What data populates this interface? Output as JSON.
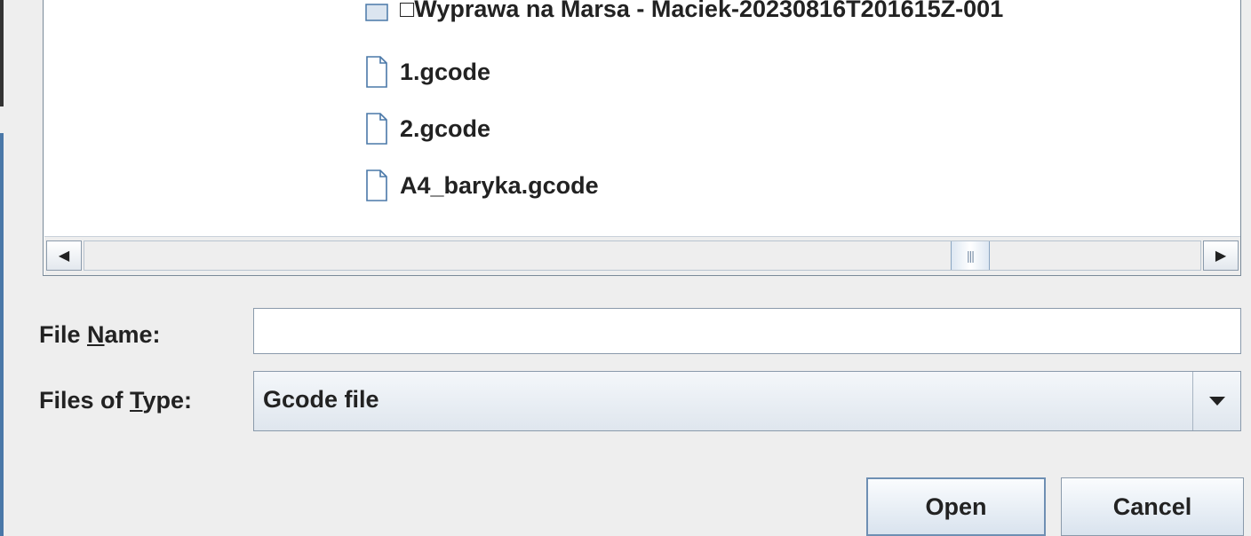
{
  "file_list": {
    "items": [
      {
        "name": "□Wyprawa na Marsa - Maciek-20230816T201615Z-001",
        "icon": "folder-icon"
      },
      {
        "name": "1.gcode",
        "icon": "file-icon"
      },
      {
        "name": "2.gcode",
        "icon": "file-icon"
      },
      {
        "name": "A4_baryka.gcode",
        "icon": "file-icon"
      }
    ]
  },
  "file_name": {
    "label_prefix": "File ",
    "label_mnemonic": "N",
    "label_suffix": "ame:",
    "value": ""
  },
  "file_type": {
    "label_prefix": "Files of ",
    "label_mnemonic": "T",
    "label_suffix": "ype:",
    "selected": "Gcode file"
  },
  "buttons": {
    "open": "Open",
    "cancel": "Cancel"
  },
  "colors": {
    "icon_stroke": "#4a78a8",
    "background": "#eeeeee"
  }
}
